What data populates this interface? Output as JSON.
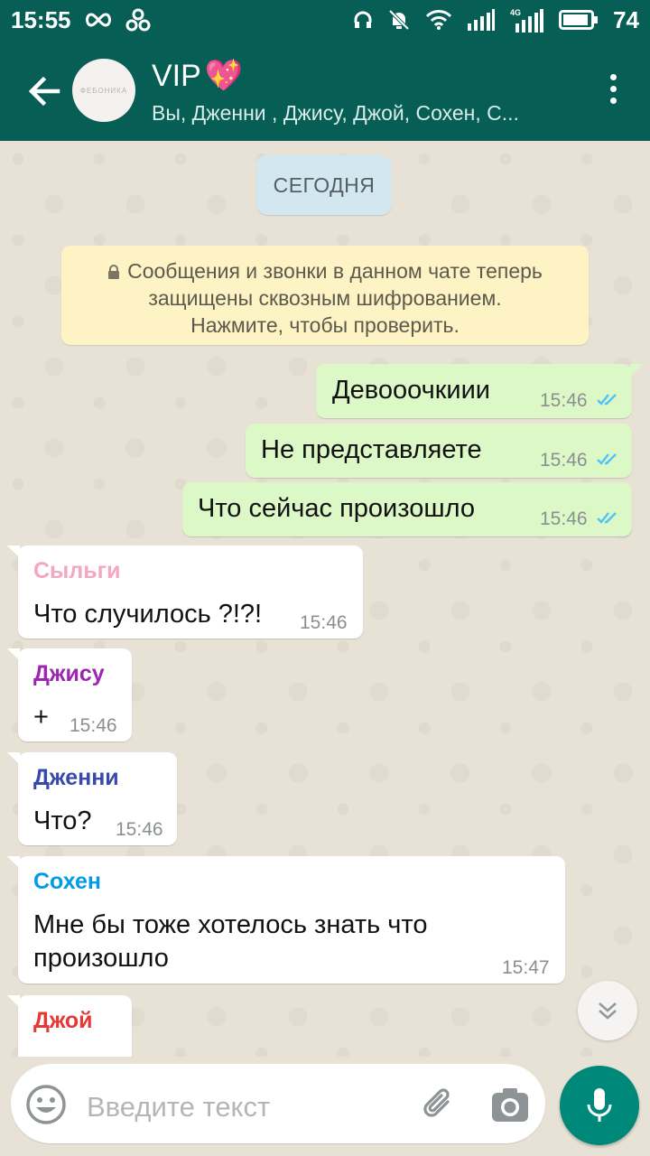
{
  "status_bar": {
    "time": "15:55",
    "battery": "74",
    "network": "4G"
  },
  "header": {
    "title": "VIP",
    "title_emoji": "💖",
    "subtitle": "Вы, Дженни , Джису, Джой, Сохен, С...",
    "avatar_text": "ФЕБОНИКА"
  },
  "chat": {
    "date_label": "СЕГОДНЯ",
    "e2e_notice": {
      "line1": "Сообщения и звонки в данном чате теперь",
      "line2": "защищены сквозным шифрованием.",
      "line3": "Нажмите, чтобы проверить."
    },
    "messages": [
      {
        "direction": "out",
        "text": "Девооочкиии",
        "time": "15:46"
      },
      {
        "direction": "out",
        "text": "Не представляете",
        "time": "15:46"
      },
      {
        "direction": "out",
        "text": "Что сейчас произошло",
        "time": "15:46"
      },
      {
        "direction": "in",
        "sender": "Сыльги",
        "sender_color": "#f4a7c3",
        "text": "Что случилось ?!?!",
        "time": "15:46"
      },
      {
        "direction": "in",
        "sender": "Джису",
        "sender_color": "#9c27b0",
        "text": "+",
        "time": "15:46"
      },
      {
        "direction": "in",
        "sender": "Дженни",
        "sender_color": "#3949ab",
        "text": "Что?",
        "time": "15:46"
      },
      {
        "direction": "in",
        "sender": "Сохен",
        "sender_color": "#039be5",
        "text_line1": "Мне бы тоже хотелось знать что",
        "text_line2": "произошло",
        "time": "15:47"
      },
      {
        "direction": "in",
        "sender": "Джой",
        "sender_color": "#e53935"
      }
    ]
  },
  "input": {
    "placeholder": "Введите текст"
  },
  "colors": {
    "header": "#075e54",
    "outgoing_bubble": "#dcf8c6",
    "incoming_bubble": "#ffffff",
    "mic_button": "#00897b",
    "read_ticks": "#4fc3f7"
  }
}
